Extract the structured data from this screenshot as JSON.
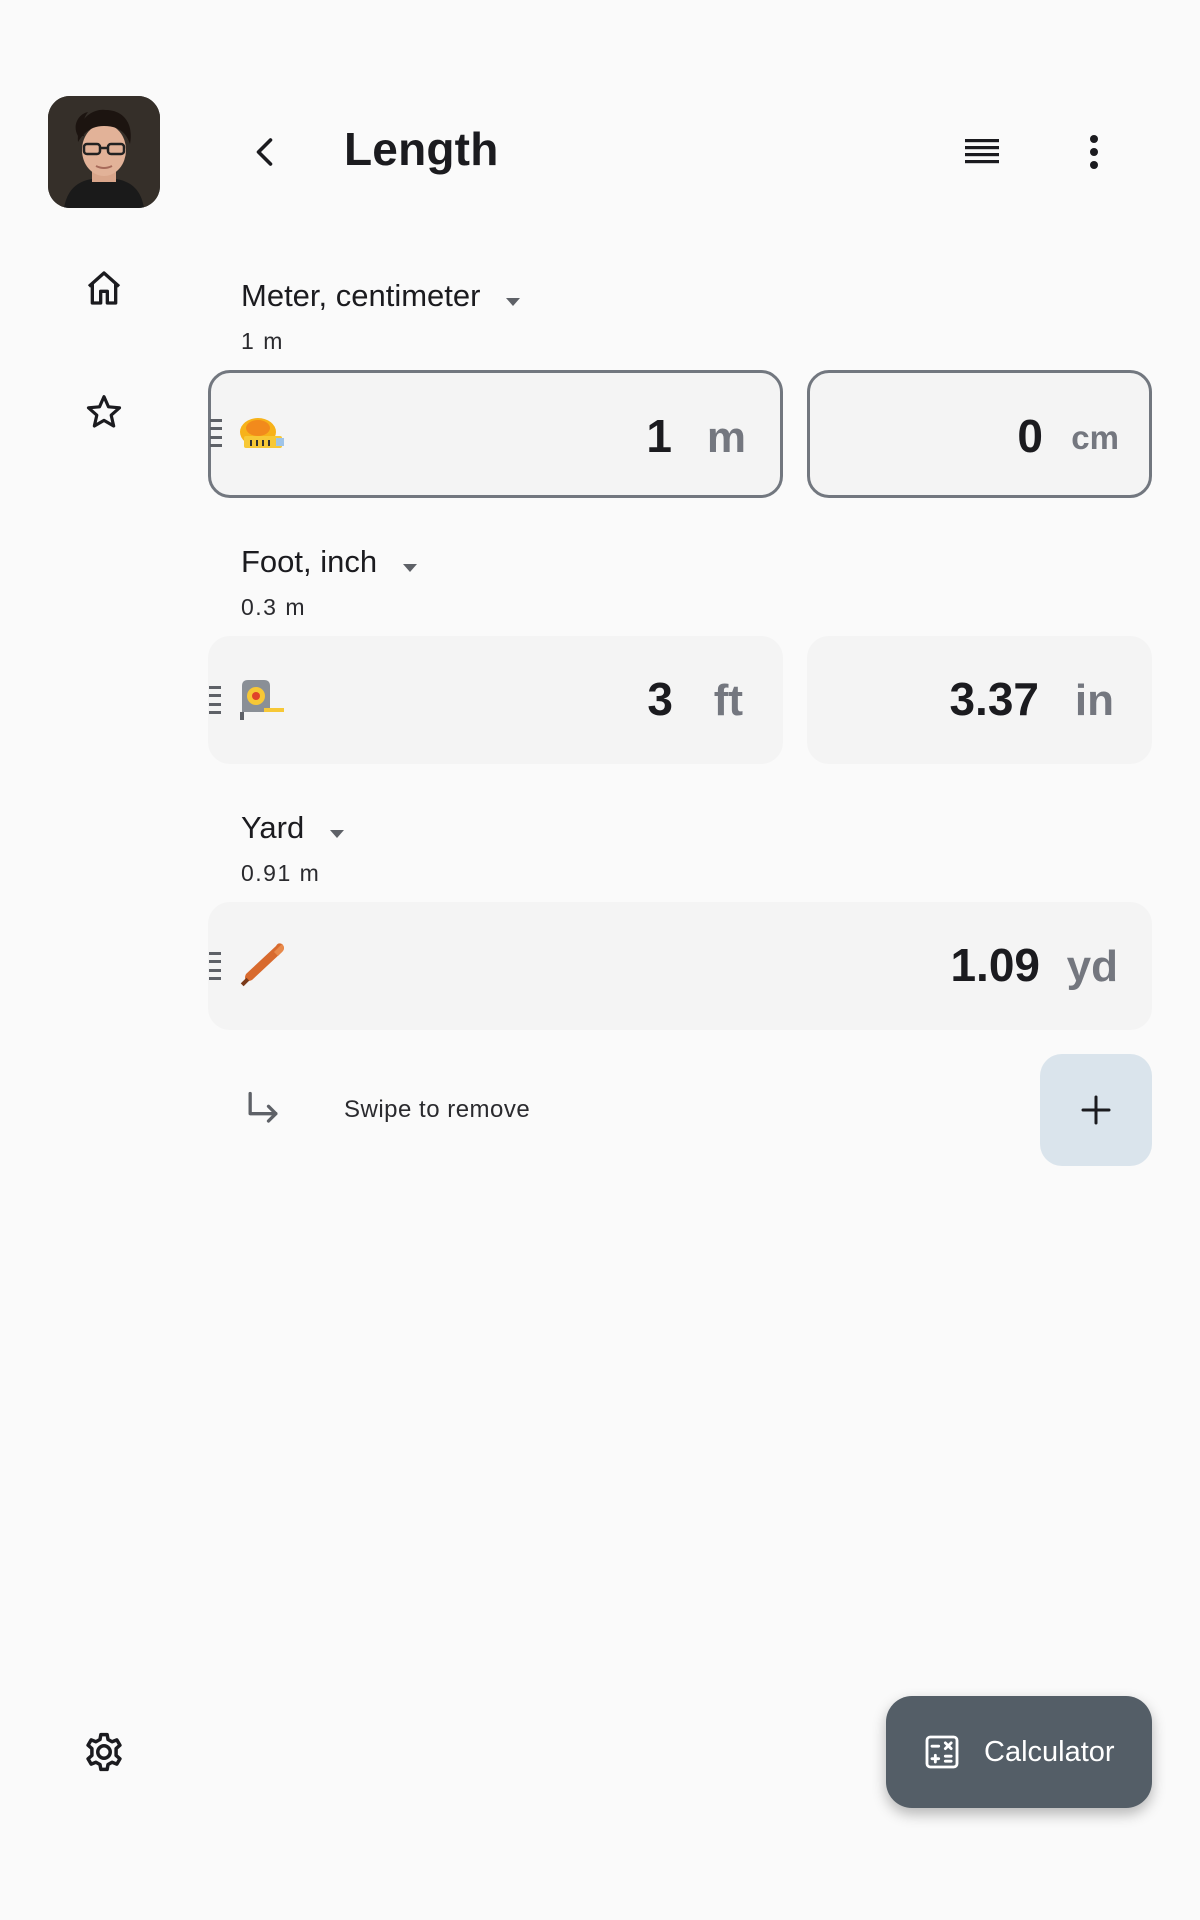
{
  "app": {
    "title": "Length"
  },
  "rail": {
    "items": [
      {
        "icon": "home-icon"
      },
      {
        "icon": "star-icon"
      }
    ],
    "settings_icon": "gear-icon"
  },
  "groups": [
    {
      "name": "Meter, centimeter",
      "sub_value": "1",
      "sub_unit": "m",
      "fields": [
        {
          "value": "1",
          "unit": "m",
          "icon": "measuring-tape-icon"
        },
        {
          "value": "0",
          "unit": "cm"
        }
      ]
    },
    {
      "name": "Foot, inch",
      "sub_value": "0.3",
      "sub_unit": "m",
      "fields": [
        {
          "value": "3",
          "unit": "ft",
          "icon": "tape-measure-icon"
        },
        {
          "value": "3.37",
          "unit": "in"
        }
      ]
    },
    {
      "name": "Yard",
      "sub_value": "0.91",
      "sub_unit": "m",
      "fields": [
        {
          "value": "1.09",
          "unit": "yd",
          "icon": "baseball-bat-icon"
        }
      ]
    }
  ],
  "hint": {
    "text": "Swipe to remove"
  },
  "fab": {
    "label": "Calculator"
  },
  "colors": {
    "background": "#fafafa",
    "field": "#f4f4f4",
    "outline": "#72777f",
    "unit_text": "#74777f",
    "add_button": "#dae4ec",
    "fab": "#545e67"
  }
}
